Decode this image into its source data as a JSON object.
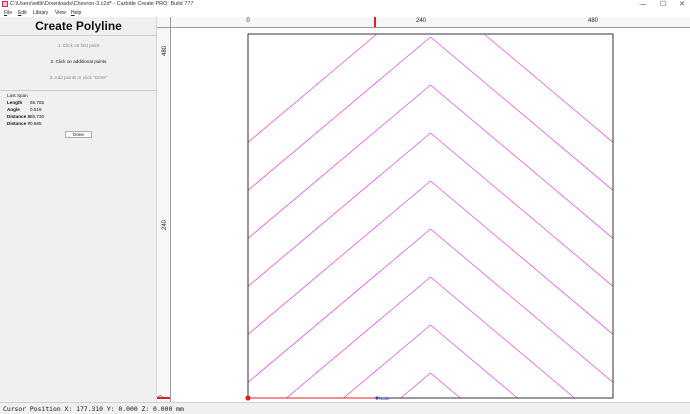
{
  "window": {
    "title": "C:\\Users\\willk\\Downloads\\Chevron-3.c2d* - Carbide Create PRO: Build 777",
    "minimize": "—",
    "maximize": "☐",
    "close": "✕"
  },
  "menu": {
    "file": "F",
    "file_rest": "ile",
    "edit": "E",
    "edit_rest": "dit",
    "library": "Library",
    "view": "View",
    "help": "H",
    "help_rest": "elp"
  },
  "panel": {
    "title": "Create Polyline",
    "steps": [
      "1. Click on first point",
      "2. Click on additional points",
      "3. Add points or click \"Done\""
    ],
    "last_span_heading": "Last Span",
    "fields": [
      {
        "label": "Length",
        "value": "65.755"
      },
      {
        "label": "Angle",
        "value": "0.519"
      },
      {
        "label": "Distance X",
        "value": "65.730"
      },
      {
        "label": "Distance Y",
        "value": "0.585"
      }
    ],
    "done_label": "Done"
  },
  "rulers": {
    "x_labels": [
      "0",
      "240",
      "480"
    ],
    "y_labels": [
      "480",
      "240",
      "0"
    ]
  },
  "canvas": {
    "snap_label": "Node",
    "line_color": "#e040e0",
    "border_color": "#333333",
    "cursor_color": "#e02020"
  },
  "status": {
    "cursor_position": "Cursor Position X: 177.310 Y: 0.000 Z: 0.000 mm"
  }
}
